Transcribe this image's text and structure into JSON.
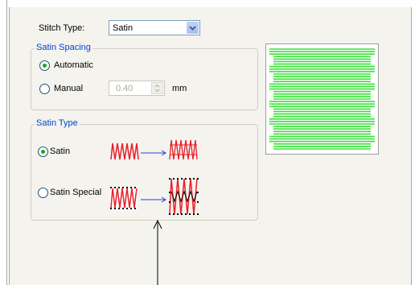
{
  "stitch_type": {
    "label": "Stitch Type:",
    "value": "Satin"
  },
  "satin_spacing": {
    "title": "Satin Spacing",
    "automatic_label": "Automatic",
    "manual_label": "Manual",
    "manual_value": "0.40",
    "unit": "mm",
    "selected": "Automatic"
  },
  "satin_type": {
    "title": "Satin Type",
    "option_satin": "Satin",
    "option_satin_special": "Satin Special",
    "selected": "Satin"
  },
  "colors": {
    "accent_title": "#0046d5",
    "stitch_red": "#e8202a",
    "preview_green": "#39e039",
    "arrow_blue": "#2b3fd6"
  }
}
